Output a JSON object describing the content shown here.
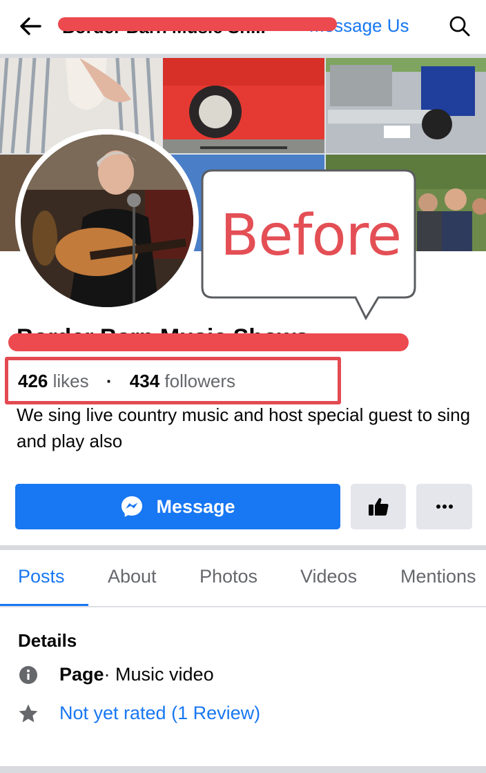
{
  "header": {
    "page_title": "Border Barn Music Sh...",
    "message_us": "Message Us"
  },
  "callout": {
    "text": "Before"
  },
  "profile": {
    "name": "Border Barn Music Shows",
    "likes_count": "426",
    "likes_label": "likes",
    "followers_count": "434",
    "followers_label": "followers",
    "bio": "We sing live country music and host special guest to sing and play also"
  },
  "actions": {
    "message_label": "Message"
  },
  "tabs": [
    "Posts",
    "About",
    "Photos",
    "Videos",
    "Mentions"
  ],
  "details": {
    "title": "Details",
    "category_label": "Page",
    "category_value": " · Music video",
    "rating": "Not yet rated (1 Review)"
  },
  "colors": {
    "accent": "#1877f2",
    "annotation_red": "#e34f55"
  },
  "icons": [
    "back-arrow-icon",
    "search-icon",
    "messenger-icon",
    "thumbs-up-icon",
    "more-icon",
    "info-icon",
    "star-icon"
  ]
}
